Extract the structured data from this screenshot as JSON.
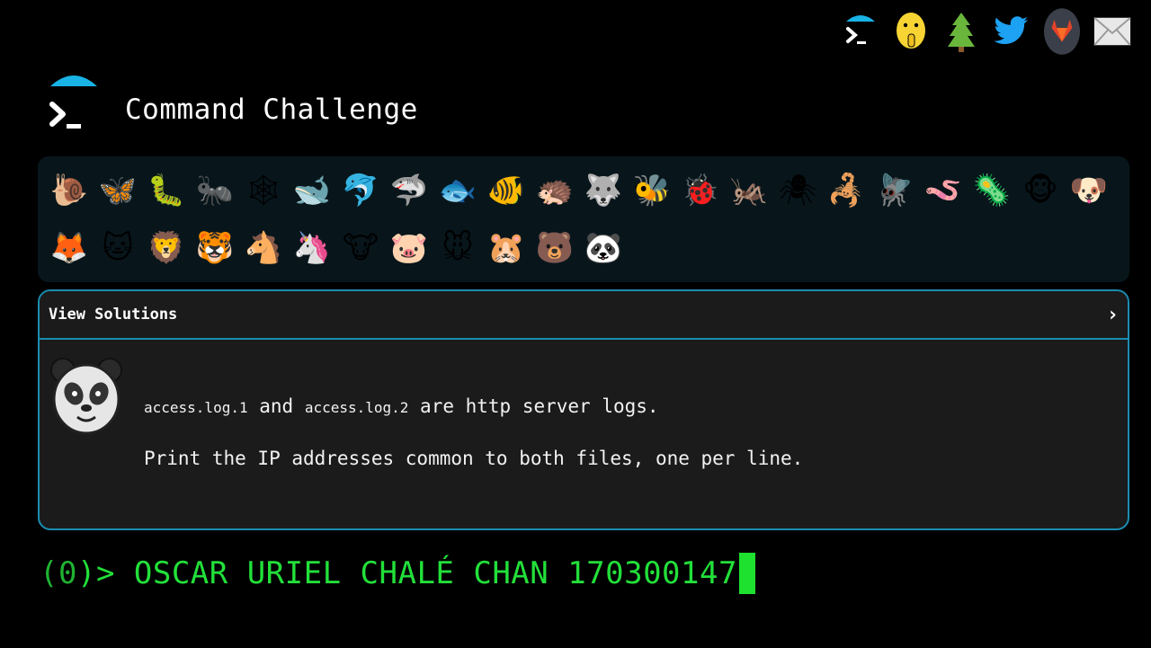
{
  "header": {
    "title": "Command Challenge",
    "icons": [
      {
        "name": "terminal-logo-icon",
        "kind": "terminal"
      },
      {
        "name": "shushing-face-icon",
        "kind": "emoji",
        "glyph": "🤫"
      },
      {
        "name": "tree-icon",
        "kind": "emoji",
        "glyph": "🌲"
      },
      {
        "name": "twitter-icon",
        "kind": "emoji",
        "glyph": "🐦"
      },
      {
        "name": "gitlab-icon",
        "kind": "gitlab"
      },
      {
        "name": "mail-icon",
        "kind": "emoji",
        "glyph": "✉"
      }
    ]
  },
  "animals": {
    "row1": [
      {
        "name": "snail",
        "glyph": "🐌"
      },
      {
        "name": "butterfly",
        "glyph": "🦋"
      },
      {
        "name": "caterpillar",
        "glyph": "🐛"
      },
      {
        "name": "ant",
        "glyph": "🐜"
      },
      {
        "name": "spider-web",
        "glyph": "🕸"
      },
      {
        "name": "whale",
        "glyph": "🐋"
      },
      {
        "name": "dolphin",
        "glyph": "🐬"
      },
      {
        "name": "shark",
        "glyph": "🦈"
      },
      {
        "name": "fish",
        "glyph": "🐟"
      },
      {
        "name": "tropical-fish",
        "glyph": "🐠"
      },
      {
        "name": "hedgehog",
        "glyph": "🦔"
      },
      {
        "name": "wolf",
        "glyph": "🐺"
      },
      {
        "name": "bee",
        "glyph": "🐝"
      },
      {
        "name": "ladybug",
        "glyph": "🐞"
      },
      {
        "name": "cricket",
        "glyph": "🦗"
      },
      {
        "name": "spider",
        "glyph": "🕷"
      },
      {
        "name": "scorpion",
        "glyph": "🦂"
      },
      {
        "name": "fly",
        "glyph": "🪰"
      },
      {
        "name": "worm",
        "glyph": "🪱"
      },
      {
        "name": "microbe",
        "glyph": "🦠"
      },
      {
        "name": "monkey",
        "glyph": "🐵"
      },
      {
        "name": "dog",
        "glyph": "🐶"
      }
    ],
    "row2": [
      {
        "name": "fox",
        "glyph": "🦊"
      },
      {
        "name": "cat",
        "glyph": "🐱"
      },
      {
        "name": "lion",
        "glyph": "🦁"
      },
      {
        "name": "tiger",
        "glyph": "🐯"
      },
      {
        "name": "horse",
        "glyph": "🐴"
      },
      {
        "name": "unicorn",
        "glyph": "🦄"
      },
      {
        "name": "cow",
        "glyph": "🐮"
      },
      {
        "name": "pig",
        "glyph": "🐷"
      },
      {
        "name": "mouse",
        "glyph": "🐭"
      },
      {
        "name": "hamster",
        "glyph": "🐹"
      },
      {
        "name": "bear",
        "glyph": "🐻"
      },
      {
        "name": "panda",
        "glyph": "🐼"
      }
    ]
  },
  "challenge": {
    "view_solutions_label": "View Solutions",
    "chevron": "›",
    "file1": "access.log.1",
    "and_text": " and ",
    "file2": "access.log.2",
    "desc1_rest": " are http server logs.",
    "desc2": "Print the IP addresses common to both files, one per line."
  },
  "prompt": {
    "counter_open": "(",
    "counter_value": "0",
    "counter_close": ")>",
    "input_value": " OSCAR URIEL CHALÉ CHAN 170300147"
  },
  "colors": {
    "accent": "#1a8db0",
    "prompt_green": "#22e03a",
    "background": "#000000",
    "card_bg": "#1b1b1b",
    "panel_bg": "#08161c"
  }
}
